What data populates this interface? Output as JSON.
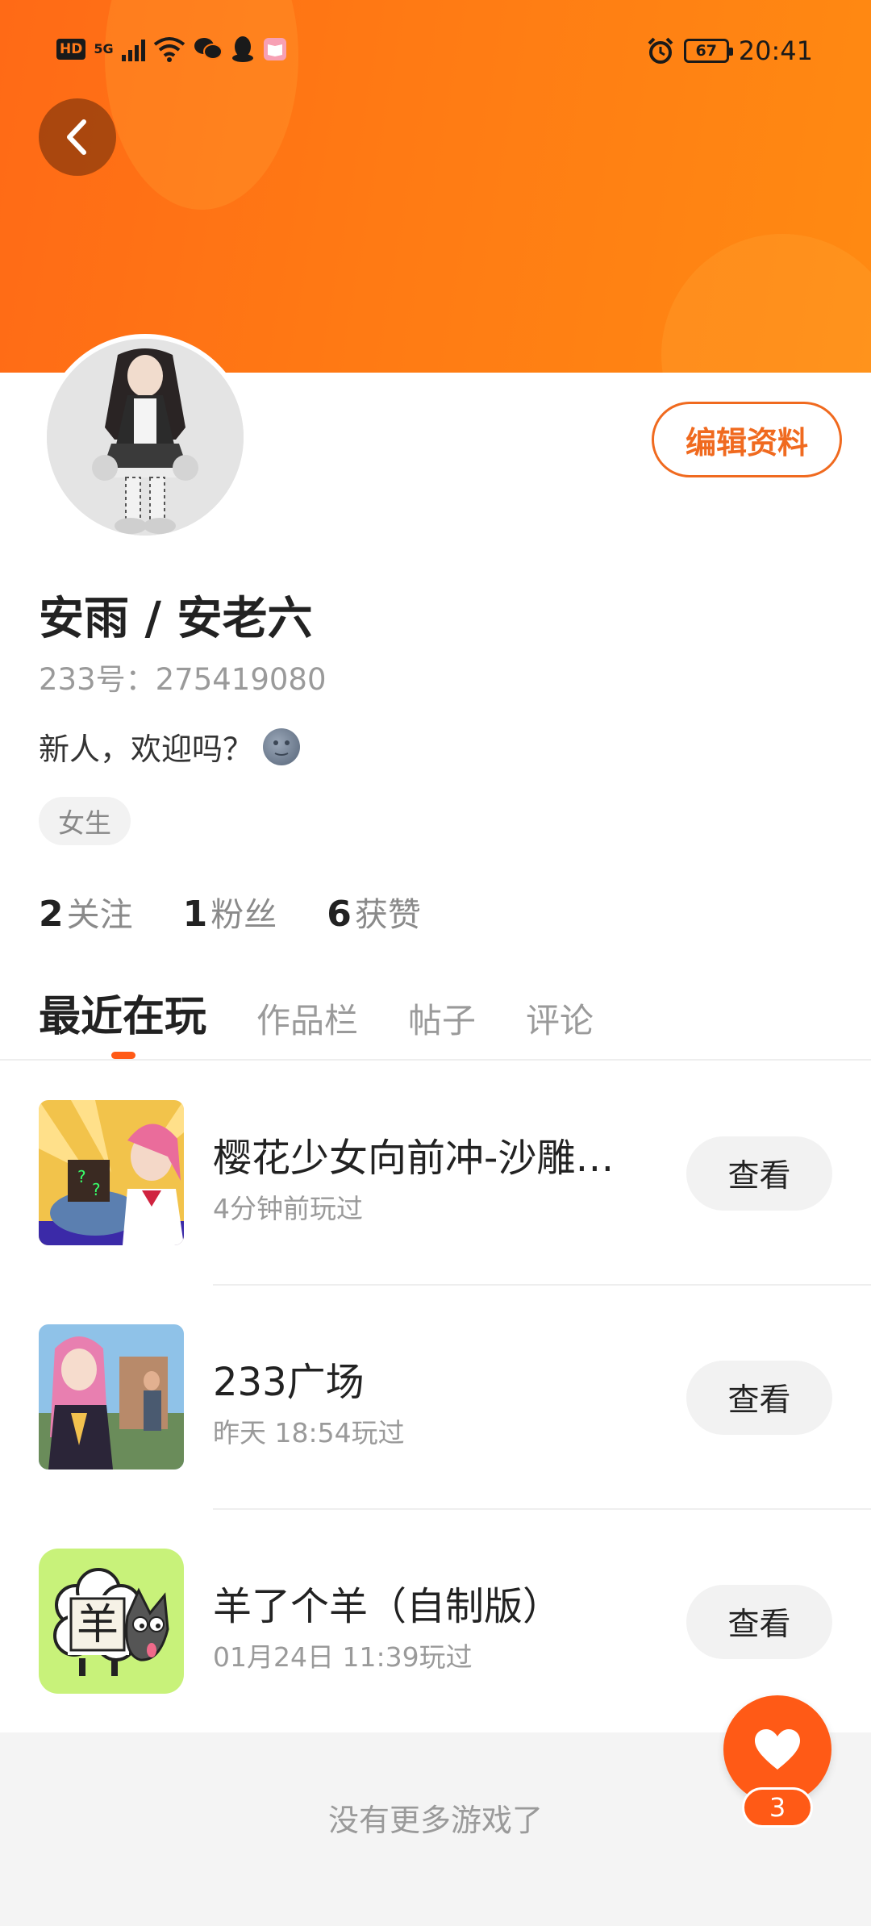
{
  "status_bar": {
    "hd": "HD",
    "network": "5G",
    "battery": "67",
    "time": "20:41",
    "icons": [
      "hd-icon",
      "signal-icon",
      "wifi-icon",
      "wechat-icon",
      "qq-icon",
      "reader-app-icon",
      "alarm-icon",
      "battery-icon"
    ]
  },
  "profile": {
    "name": "安雨 / 安老六",
    "id_text": "233号：275419080",
    "bio": "新人，欢迎吗？",
    "bio_emoji": "new-moon-face-emoji",
    "tag": "女生",
    "edit_label": "编辑资料"
  },
  "stats": [
    {
      "value": "2",
      "label": "关注"
    },
    {
      "value": "1",
      "label": "粉丝"
    },
    {
      "value": "6",
      "label": "获赞"
    }
  ],
  "tabs": [
    {
      "label": "最近在玩",
      "active": true
    },
    {
      "label": "作品栏",
      "active": false
    },
    {
      "label": "帖子",
      "active": false
    },
    {
      "label": "评论",
      "active": false
    }
  ],
  "games": [
    {
      "title": "樱花少女向前冲-沙雕大…",
      "time": "4分钟前玩过",
      "button": "查看"
    },
    {
      "title": "233广场",
      "time": "昨天 18:54玩过",
      "button": "查看"
    },
    {
      "title": "羊了个羊（自制版）",
      "time": "01月24日 11:39玩过",
      "button": "查看"
    }
  ],
  "game3_icon_char": "羊",
  "footer": {
    "text": "没有更多游戏了"
  },
  "fab": {
    "badge": "3"
  },
  "colors": {
    "accent": "#ff5a16",
    "header": "#ff7a14"
  }
}
